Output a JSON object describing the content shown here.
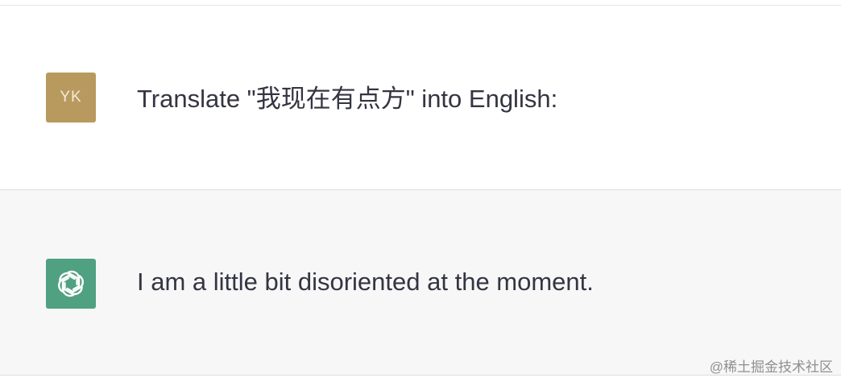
{
  "conversation": {
    "user_message": {
      "avatar_initials": "YK",
      "avatar_color": "#b99a5e",
      "text": "Translate \"我现在有点方\" into English:"
    },
    "assistant_message": {
      "avatar_icon": "openai-logo-icon",
      "avatar_color": "#4fa181",
      "text": "I am a little bit disoriented at the moment."
    }
  },
  "watermark": {
    "text": "@稀土掘金技术社区"
  }
}
